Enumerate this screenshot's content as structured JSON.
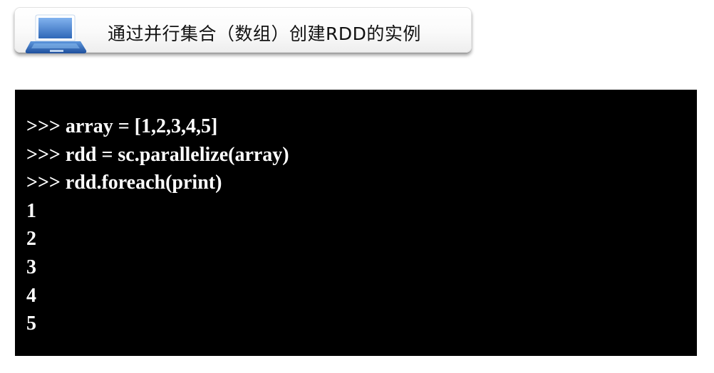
{
  "header": {
    "title": "通过并行集合（数组）创建RDD的实例",
    "icon": "laptop-icon"
  },
  "terminal": {
    "lines": [
      ">>> array = [1,2,3,4,5]",
      ">>> rdd = sc.parallelize(array)",
      ">>> rdd.foreach(print)",
      "1",
      "2",
      "3",
      "4",
      "5"
    ]
  },
  "colors": {
    "terminal_background": "#000000",
    "terminal_text": "#ffffff",
    "icon_blue": "#3e78c6"
  }
}
